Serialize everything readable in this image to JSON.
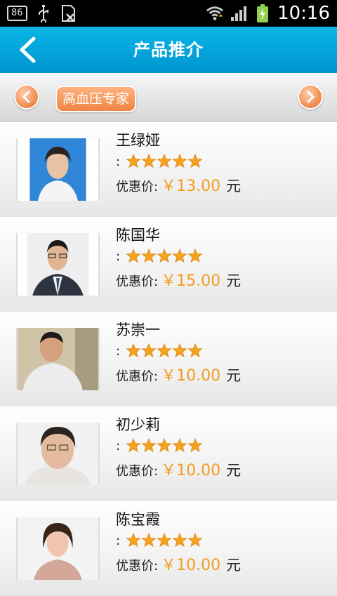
{
  "status": {
    "badge": "86",
    "time": "10:16"
  },
  "header": {
    "title": "产品推介"
  },
  "category": {
    "label": "高血压专家"
  },
  "items": [
    {
      "name": "王绿娅",
      "rating_prefix": ":",
      "stars": 5,
      "price_label": "优惠价:",
      "price": "￥13.00",
      "unit": "元"
    },
    {
      "name": "陈国华",
      "rating_prefix": ":",
      "stars": 5,
      "price_label": "优惠价:",
      "price": "￥15.00",
      "unit": "元"
    },
    {
      "name": "苏崇一",
      "rating_prefix": ":",
      "stars": 5,
      "price_label": "优惠价:",
      "price": "￥10.00",
      "unit": "元"
    },
    {
      "name": "初少莉",
      "rating_prefix": ":",
      "stars": 5,
      "price_label": "优惠价:",
      "price": "￥10.00",
      "unit": "元"
    },
    {
      "name": "陈宝霞",
      "rating_prefix": ":",
      "stars": 5,
      "price_label": "优惠价:",
      "price": "￥10.00",
      "unit": "元"
    }
  ],
  "colors": {
    "titlebar": "#0aa8df",
    "price": "#f29c1f",
    "star": "#f7a21e",
    "accent": "#ee8544"
  }
}
